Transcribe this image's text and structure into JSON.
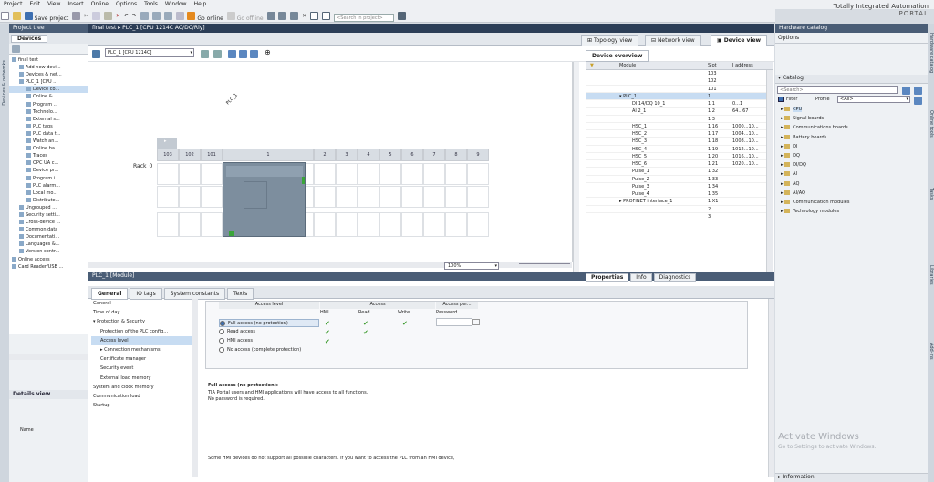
{
  "menu": [
    "Project",
    "Edit",
    "View",
    "Insert",
    "Online",
    "Options",
    "Tools",
    "Window",
    "Help"
  ],
  "brand": {
    "line1": "Totally Integrated Automation",
    "line2": "PORTAL"
  },
  "toolbar": {
    "save": "Save project",
    "go_online": "Go online",
    "go_offline": "Go offline",
    "search_placeholder": "<Search in project>"
  },
  "left_strip_label": "Devices & networks",
  "project_tree": {
    "title": "Project tree",
    "tab": "Devices",
    "items": [
      {
        "label": "final test",
        "indent": 0
      },
      {
        "label": "Add new devi...",
        "indent": 1
      },
      {
        "label": "Devices & net...",
        "indent": 1
      },
      {
        "label": "PLC_1 [CPU ...",
        "indent": 1
      },
      {
        "label": "Device co...",
        "indent": 2,
        "selected": true
      },
      {
        "label": "Online & ...",
        "indent": 2
      },
      {
        "label": "Program ...",
        "indent": 2
      },
      {
        "label": "Technolo...",
        "indent": 2
      },
      {
        "label": "External s...",
        "indent": 2
      },
      {
        "label": "PLC tags",
        "indent": 2
      },
      {
        "label": "PLC data t...",
        "indent": 2
      },
      {
        "label": "Watch an...",
        "indent": 2
      },
      {
        "label": "Online ba...",
        "indent": 2
      },
      {
        "label": "Traces",
        "indent": 2
      },
      {
        "label": "OPC UA c...",
        "indent": 2
      },
      {
        "label": "Device pr...",
        "indent": 2
      },
      {
        "label": "Program i...",
        "indent": 2
      },
      {
        "label": "PLC alarm...",
        "indent": 2
      },
      {
        "label": "Local mo...",
        "indent": 2
      },
      {
        "label": "Distribute...",
        "indent": 2
      },
      {
        "label": "Ungrouped ...",
        "indent": 1
      },
      {
        "label": "Security setti...",
        "indent": 1
      },
      {
        "label": "Cross-device ...",
        "indent": 1
      },
      {
        "label": "Common data",
        "indent": 1
      },
      {
        "label": "Documentati...",
        "indent": 1
      },
      {
        "label": "Languages &...",
        "indent": 1
      },
      {
        "label": "Version contr...",
        "indent": 1
      },
      {
        "label": "Online access",
        "indent": 0
      },
      {
        "label": "Card Reader/USB ...",
        "indent": 0
      }
    ],
    "details_title": "Details view",
    "details_col": "Name"
  },
  "editor": {
    "title": "final test ▸ PLC_1 [CPU 1214C AC/DC/Rly]",
    "views": [
      "Topology view",
      "Network view",
      "Device view"
    ],
    "device_select": "PLC_1 [CPU 1214C]",
    "device_label": "PLC_1",
    "rack_label": "Rack_0",
    "slots": [
      "103",
      "102",
      "101",
      "1",
      "2",
      "3",
      "4",
      "5",
      "6",
      "7",
      "8",
      "9"
    ],
    "zoom": "100%"
  },
  "overview": {
    "title": "Device overview",
    "headers": {
      "module": "Module",
      "slot": "Slot",
      "iaddr": "I address"
    },
    "rows": [
      {
        "module": "",
        "slot": "103",
        "iaddr": ""
      },
      {
        "module": "",
        "slot": "102",
        "iaddr": ""
      },
      {
        "module": "",
        "slot": "101",
        "iaddr": ""
      },
      {
        "module": "▾ PLC_1",
        "slot": "1",
        "iaddr": "",
        "selected": true
      },
      {
        "module": "DI 14/DQ 10_1",
        "slot": "1 1",
        "iaddr": "0...1"
      },
      {
        "module": "AI 2_1",
        "slot": "1 2",
        "iaddr": "64...67"
      },
      {
        "module": "",
        "slot": "1 3",
        "iaddr": ""
      },
      {
        "module": "HSC_1",
        "slot": "1 16",
        "iaddr": "1000...10..."
      },
      {
        "module": "HSC_2",
        "slot": "1 17",
        "iaddr": "1004...10..."
      },
      {
        "module": "HSC_3",
        "slot": "1 18",
        "iaddr": "1008...10..."
      },
      {
        "module": "HSC_4",
        "slot": "1 19",
        "iaddr": "1012...10..."
      },
      {
        "module": "HSC_5",
        "slot": "1 20",
        "iaddr": "1016...10..."
      },
      {
        "module": "HSC_6",
        "slot": "1 21",
        "iaddr": "1020...10..."
      },
      {
        "module": "Pulse_1",
        "slot": "1 32",
        "iaddr": ""
      },
      {
        "module": "Pulse_2",
        "slot": "1 33",
        "iaddr": ""
      },
      {
        "module": "Pulse_3",
        "slot": "1 34",
        "iaddr": ""
      },
      {
        "module": "Pulse_4",
        "slot": "1 35",
        "iaddr": ""
      },
      {
        "module": "▸ PROFINET interface_1",
        "slot": "1 X1",
        "iaddr": ""
      },
      {
        "module": "",
        "slot": "2",
        "iaddr": ""
      },
      {
        "module": "",
        "slot": "3",
        "iaddr": ""
      }
    ]
  },
  "inspector": {
    "title": "PLC_1 [Module]",
    "right_tabs": [
      "Properties",
      "Info",
      "Diagnostics"
    ],
    "tabs": [
      "General",
      "IO tags",
      "System constants",
      "Texts"
    ],
    "nav": [
      {
        "label": "General",
        "indent": 0
      },
      {
        "label": "Time of day",
        "indent": 0
      },
      {
        "label": "▾ Protection & Security",
        "indent": 0
      },
      {
        "label": "Protection of the PLC config...",
        "indent": 1
      },
      {
        "label": "Access level",
        "indent": 1,
        "selected": true
      },
      {
        "label": "▸ Connection mechanisms",
        "indent": 1
      },
      {
        "label": "Certificate manager",
        "indent": 1
      },
      {
        "label": "Security event",
        "indent": 1
      },
      {
        "label": "External load memory",
        "indent": 1
      },
      {
        "label": "System and clock memory",
        "indent": 0
      },
      {
        "label": "Communication load",
        "indent": 0
      },
      {
        "label": "Startup",
        "indent": 0
      }
    ],
    "table_headers": {
      "access_level": "Access level",
      "access": "Access",
      "access_perm": "Access per...",
      "hmi": "HMI",
      "read": "Read",
      "write": "Write",
      "password": "Password"
    },
    "levels": [
      {
        "label": "Full access (no protection)",
        "hmi": true,
        "read": true,
        "write": true,
        "selected": true
      },
      {
        "label": "Read access",
        "hmi": true,
        "read": true,
        "write": false
      },
      {
        "label": "HMI access",
        "hmi": true,
        "read": false,
        "write": false
      },
      {
        "label": "No access (complete protection)",
        "hmi": false,
        "read": false,
        "write": false
      }
    ],
    "desc_title": "Full access (no protection):",
    "desc_line1": "TIA Portal users and HMI applications will have access to all functions.",
    "desc_line2": "No password is required.",
    "footer": "Some HMI devices do not support all possible characters. If you want to access the PLC from an HMI device,"
  },
  "catalog": {
    "title": "Hardware catalog",
    "options": "Options",
    "catalog_label": "Catalog",
    "search_placeholder": "<Search>",
    "filter": "Filter",
    "profile_label": "Profile",
    "profile_value": "<All>",
    "items": [
      "CPU",
      "Signal boards",
      "Communications boards",
      "Battery boards",
      "DI",
      "DQ",
      "DI/DQ",
      "AI",
      "AQ",
      "AI/AQ",
      "Communication modules",
      "Technology modules"
    ],
    "activate1": "Activate Windows",
    "activate2": "Go to Settings to activate Windows.",
    "information": "Information"
  },
  "right_strip_labels": [
    "Hardware catalog",
    "Online tools",
    "Tasks",
    "Libraries",
    "Add-ins"
  ]
}
